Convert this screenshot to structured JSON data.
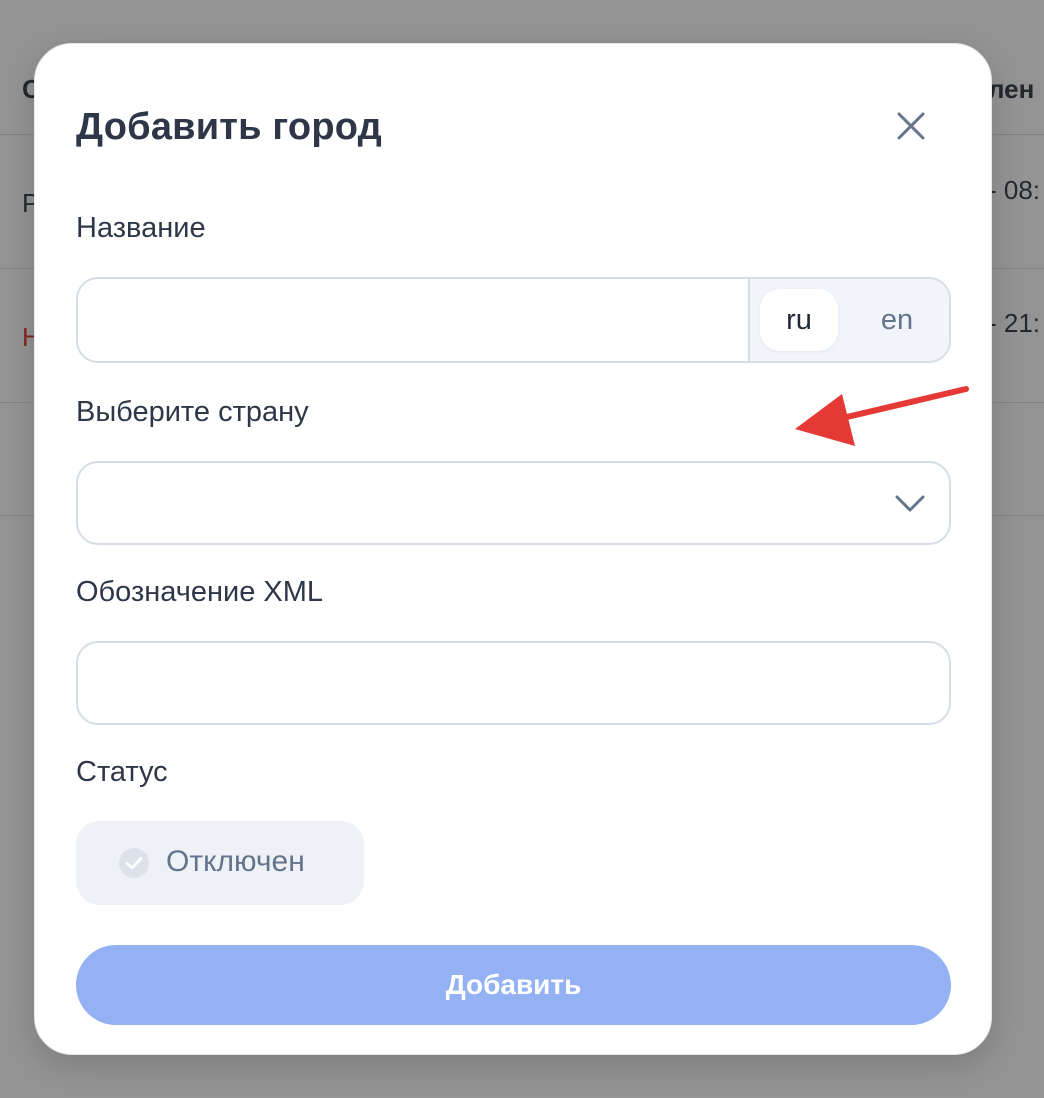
{
  "background": {
    "header_left_fragment": "C",
    "header_right_fragment": "лен",
    "row1_left_fragment": "P",
    "row1_right_fragment": "- 08:",
    "row2_left_fragment": "H",
    "row2_right_fragment": "- 21:"
  },
  "modal": {
    "title": "Добавить город",
    "close_icon": "close-icon",
    "name_field": {
      "label": "Название",
      "value": "",
      "languages": [
        {
          "code": "ru",
          "active": true
        },
        {
          "code": "en",
          "active": false
        }
      ]
    },
    "country_field": {
      "label": "Выберите страну",
      "selected": "",
      "icon": "chevron-down-icon"
    },
    "xml_field": {
      "label": "Обозначение XML",
      "value": ""
    },
    "status_field": {
      "label": "Статус",
      "toggle_label": "Отключен",
      "checked": false
    },
    "submit_label": "Добавить"
  },
  "colors": {
    "primary_disabled": "#93b1f3",
    "annotation_arrow": "#e53935",
    "text_primary": "#2d3748",
    "text_muted": "#64748b"
  }
}
